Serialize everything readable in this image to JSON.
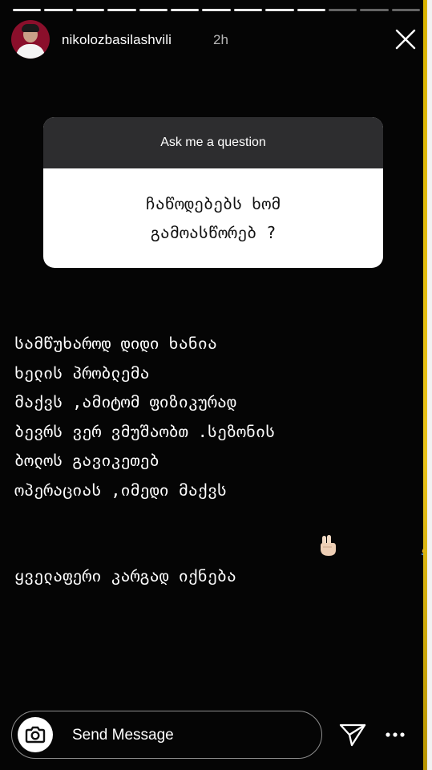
{
  "story": {
    "segments_total": 13,
    "segments_filled": 10,
    "accent_color": "#e9c21a"
  },
  "header": {
    "username": "nikolozbasilashvili",
    "time": "2h",
    "avatar_icon": "profile-avatar",
    "close_icon": "close-icon"
  },
  "sticker": {
    "title": "Ask me a question",
    "question_lines": [
      "ჩაწოდებებს ხომ",
      "გამოასწორებ ?"
    ]
  },
  "answer": {
    "lines": [
      "სამწუხაროდ დიდი ხანია",
      "ხელის პრობლემა",
      "მაქვს ,ამიტომ ფიზიკურად",
      "ბევრს ვერ ვმუშაობთ .სეზონის",
      "ბოლოს გავიკეთებ",
      "ოპერაციას ,იმედი მაქვს",
      "ყველაფერი კარგად იქნება"
    ],
    "emoji": [
      "victory-hand-icon",
      "folded-hands-icon"
    ]
  },
  "footer": {
    "message_placeholder": "Send Message",
    "camera_icon": "camera-icon",
    "send_icon": "paper-plane-icon",
    "more_icon": "more-options-icon"
  }
}
